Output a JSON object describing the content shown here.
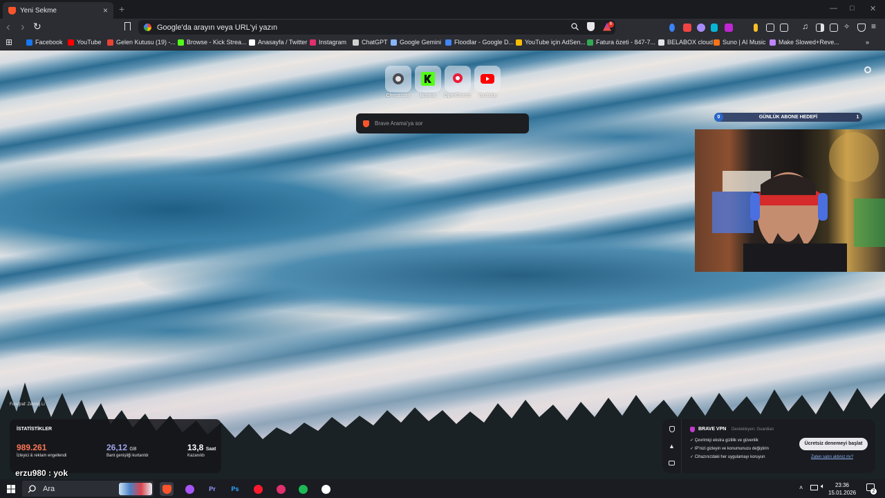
{
  "tab": {
    "title": "Yeni Sekme",
    "close": "×",
    "new_tab": "+"
  },
  "window": {
    "minimize": "—",
    "maximize": "□",
    "close": "✕"
  },
  "toolbar": {
    "back": "‹",
    "forward": "›",
    "reload": "↻",
    "omnibox_placeholder": "Google'da arayın veya URL'yi yazın",
    "rewards_badge": "6"
  },
  "bookmarks": [
    {
      "label": "Facebook",
      "icon": "facebook-icon",
      "color": "#1877f2"
    },
    {
      "label": "YouTube",
      "icon": "youtube-icon",
      "color": "#ff0000"
    },
    {
      "label": "Gelen Kutusu (19) -...",
      "icon": "gmail-icon",
      "color": "#ea4335"
    },
    {
      "label": "Browse - Kick Strea...",
      "icon": "kick-icon",
      "color": "#53fc18"
    },
    {
      "label": "Anasayfa / Twitter",
      "icon": "x-icon",
      "color": "#ffffff"
    },
    {
      "label": "Instagram",
      "icon": "instagram-icon",
      "color": "#e1306c"
    },
    {
      "label": "ChatGPT",
      "icon": "chatgpt-icon",
      "color": "#d0d0d0"
    },
    {
      "label": "Google Gemini",
      "icon": "gemini-icon",
      "color": "#8ab4f8"
    },
    {
      "label": "Floodlar - Google D...",
      "icon": "docs-icon",
      "color": "#4285f4"
    },
    {
      "label": "YouTube için AdSen...",
      "icon": "adsense-icon",
      "color": "#fbbc05"
    },
    {
      "label": "Fatura özeti - 847-7...",
      "icon": "fatura-icon",
      "color": "#34a853"
    },
    {
      "label": "BELABOX cloud",
      "icon": "belabox-icon",
      "color": "#e4e4e7"
    },
    {
      "label": "Suno | AI Music",
      "icon": "suno-icon",
      "color": "#f97316"
    },
    {
      "label": "Make Slowed+Reve...",
      "icon": "slowed-icon",
      "color": "#c084fc"
    }
  ],
  "top_sites": [
    {
      "label": "Chess.com",
      "icon": "globe-icon"
    },
    {
      "label": "Browse",
      "icon": "kick-icon"
    },
    {
      "label": "OpenGuessr",
      "icon": "location-pin-icon"
    },
    {
      "label": "YouTube",
      "icon": "youtube-icon"
    }
  ],
  "search": {
    "placeholder": "Brave Arama'ya sor"
  },
  "goal": {
    "current": "0",
    "title": "GÜNLÜK ABONE HEDEFİ",
    "target": "1"
  },
  "photo_credit": "Fotoğraf: Zetong Li",
  "stats": {
    "title": "İSTATİSTİKLER",
    "items": [
      {
        "value": "989.261",
        "unit": "",
        "label": "İzleyici & reklam engellendi",
        "color": "#ff7654"
      },
      {
        "value": "26,12",
        "unit": "GB",
        "label": "Bant genişliği kurtarıldı",
        "color": "#a0a5eb"
      },
      {
        "value": "13,8",
        "unit": "Saat",
        "label": "Kazanıldı",
        "color": "#ffffff"
      }
    ]
  },
  "overlay_text": "erzu980 : yok",
  "vpn": {
    "title": "BRAVE VPN",
    "sponsor": "Destekleyen: Guardian",
    "features": [
      "Çevrimiçi ekstra gizlilik ve güvenlik",
      "IP'nizi gizleyin ve konumunuzu değiştirin",
      "Cihazınızdaki her uygulamayı koruyun"
    ],
    "cta": "Ücretsiz denemeyi başlat",
    "link": "Zaten satın aldınız mı?"
  },
  "taskbar": {
    "search_label": "Ara",
    "time": "23:36",
    "date": "15.01.2026",
    "notification_count": "2",
    "apps": [
      {
        "name": "brave",
        "glyph": "",
        "color": "#fb542b"
      },
      {
        "name": "messenger",
        "glyph": "",
        "color": "#a855f7"
      },
      {
        "name": "premiere",
        "glyph": "Pr",
        "color": "#9999ff"
      },
      {
        "name": "photoshop",
        "glyph": "Ps",
        "color": "#31a8ff"
      },
      {
        "name": "opera",
        "glyph": "",
        "color": "#ff1b2d"
      },
      {
        "name": "instagram",
        "glyph": "",
        "color": "#e1306c"
      },
      {
        "name": "spotify",
        "glyph": "",
        "color": "#1db954"
      },
      {
        "name": "obs",
        "glyph": "",
        "color": "#ffffff"
      }
    ]
  }
}
